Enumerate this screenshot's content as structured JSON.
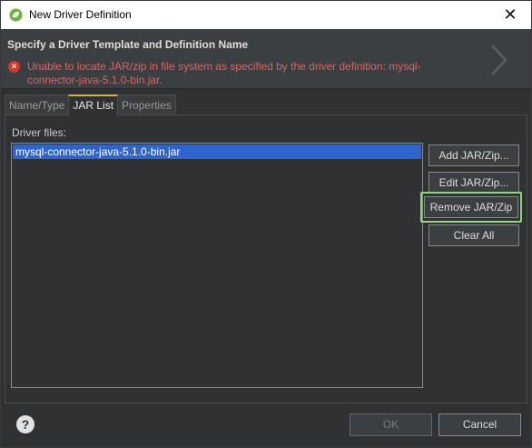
{
  "window": {
    "title": "New Driver Definition",
    "close_glyph": "✕"
  },
  "header": {
    "title": "Specify a Driver Template and Definition Name",
    "error_message": "Unable to locate JAR/zip in file system as specified by the driver definition: mysql-connector-java-5.1.0-bin.jar.",
    "error_icon": "error-icon"
  },
  "tabs": [
    {
      "label": "Name/Type",
      "active": false
    },
    {
      "label": "JAR List",
      "active": true
    },
    {
      "label": "Properties",
      "active": false
    }
  ],
  "jar_list": {
    "label": "Driver files:",
    "files": [
      "mysql-connector-java-5.1.0-bin.jar"
    ]
  },
  "buttons": {
    "add": {
      "label": "Add JAR/Zip..."
    },
    "edit": {
      "label": "Edit JAR/Zip..."
    },
    "remove": {
      "label": "Remove JAR/Zip"
    },
    "clear": {
      "label": "Clear All"
    }
  },
  "footer": {
    "help_glyph": "?",
    "ok": "OK",
    "cancel": "Cancel"
  },
  "colors": {
    "selection": "#2f65ca",
    "highlight": "#8fd67c",
    "error": "#d66565"
  }
}
